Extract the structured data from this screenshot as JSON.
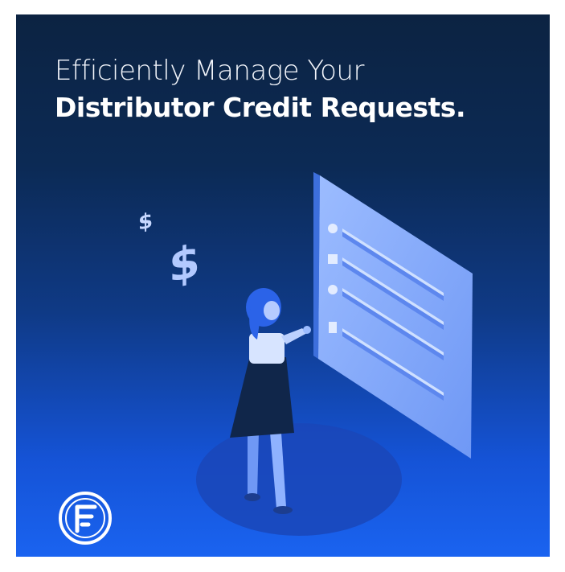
{
  "headline": {
    "line1": "Efficiently Manage Your",
    "line2": "Distributor Credit Requests."
  },
  "icons": {
    "dollar_small": "dollar-sign-icon",
    "dollar_large": "dollar-sign-icon",
    "brand_logo": "brand-f-logo-icon"
  },
  "colors": {
    "background_top": "#0c2342",
    "background_bottom": "#1a63f0",
    "panel": "#8fb2ff",
    "accent": "#ffffff"
  }
}
